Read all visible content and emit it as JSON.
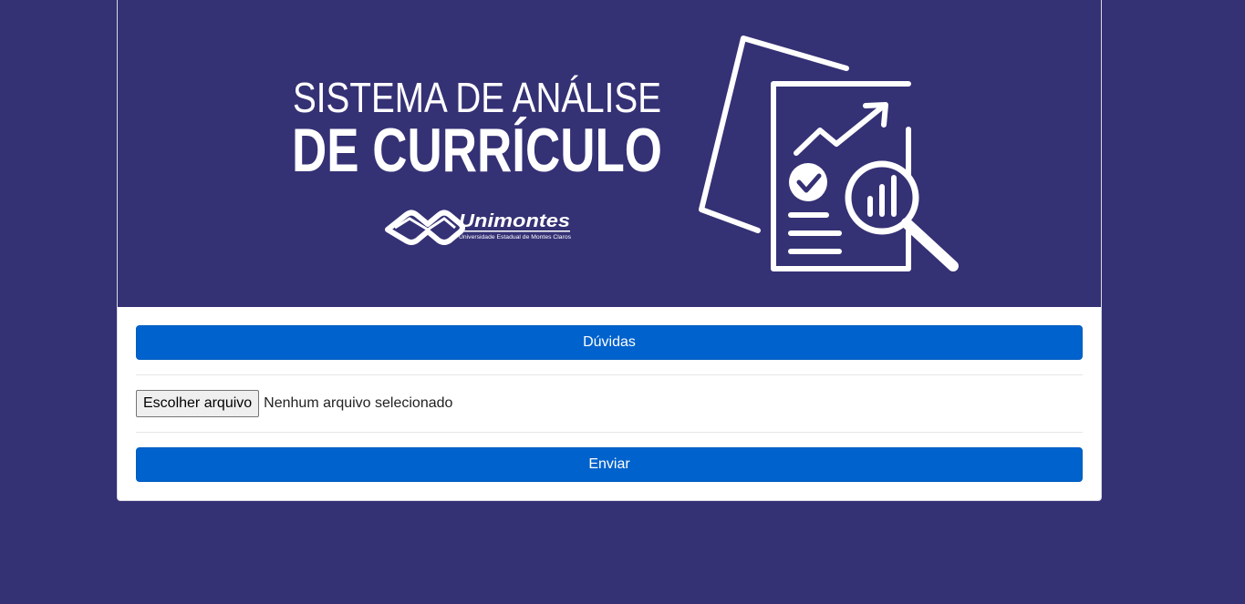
{
  "banner": {
    "title_line1": "SISTEMA DE ANÁLISE",
    "title_line2": "DE CURRÍCULO",
    "brand_name": "Unimontes",
    "brand_tagline": "Universidade Estadual de Montes Claros",
    "background_color": "#353175",
    "icon": "document-analysis-icon"
  },
  "help_button": {
    "label": "Dúvidas",
    "color": "#0062cc"
  },
  "file_input": {
    "button_label": "Escolher arquivo",
    "status_text": "Nenhum arquivo selecionado"
  },
  "submit_button": {
    "label": "Enviar",
    "color": "#0062cc"
  },
  "page": {
    "background_color": "#353175"
  }
}
